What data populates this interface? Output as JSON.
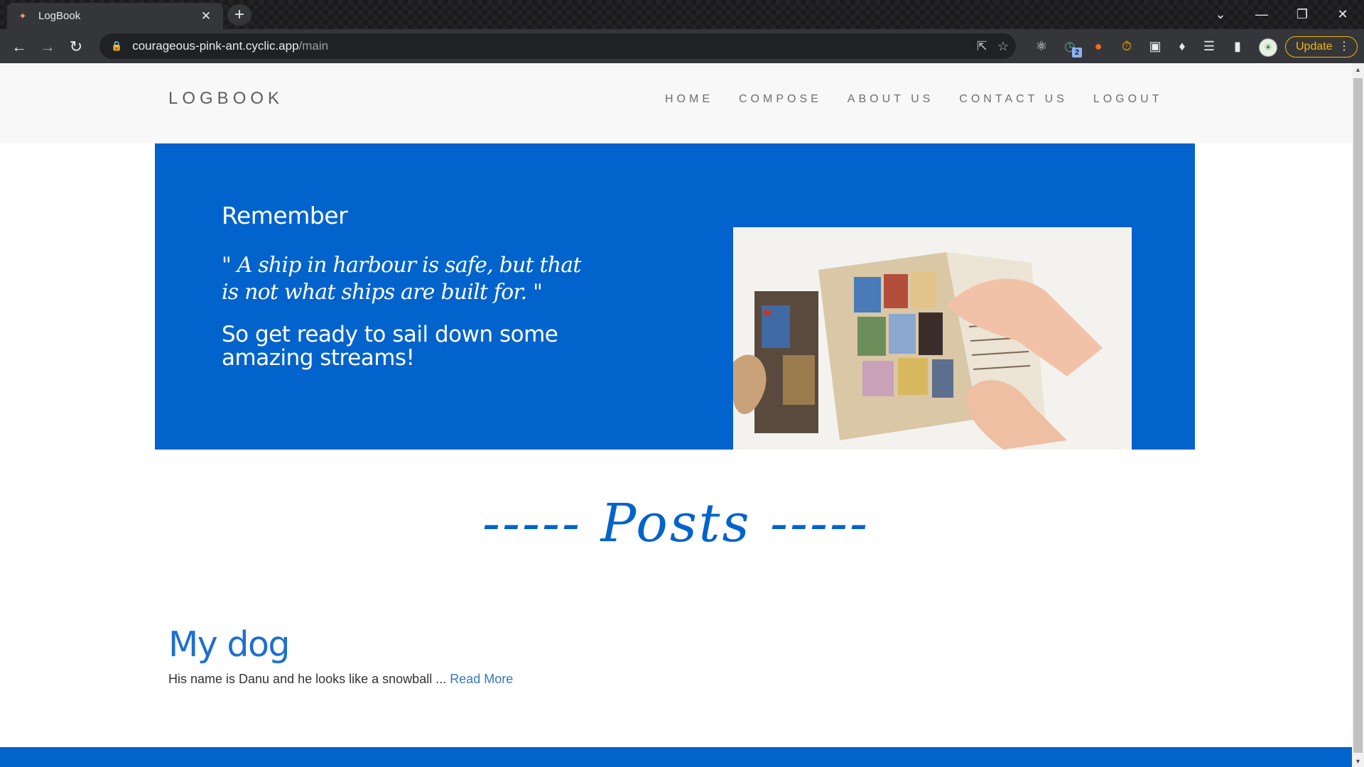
{
  "browser": {
    "tab_title": "LogBook",
    "url_host": "courageous-pink-ant.cyclic.app",
    "url_path": "/main",
    "update_label": "Update",
    "extension_badge": "2"
  },
  "site": {
    "brand": "LOGBOOK",
    "nav": [
      "HOME",
      "COMPOSE",
      "ABOUT US",
      "CONTACT US",
      "LOGOUT"
    ]
  },
  "hero": {
    "heading": "Remember",
    "quote": "\" A ship in harbour is safe, but that is not what ships are built for. \"",
    "subtext": "So get ready to sail down some amazing streams!",
    "image_icon": "journal-photo-icon"
  },
  "posts_heading": "----- Posts -----",
  "posts": [
    {
      "title": "My dog",
      "excerpt": "His name is Danu and he looks like a snowball ... ",
      "read_more": "Read More"
    }
  ],
  "colors": {
    "primary_blue": "#0263cc",
    "navbar_bg": "#f8f8f8",
    "chrome_dark": "#35363a"
  }
}
